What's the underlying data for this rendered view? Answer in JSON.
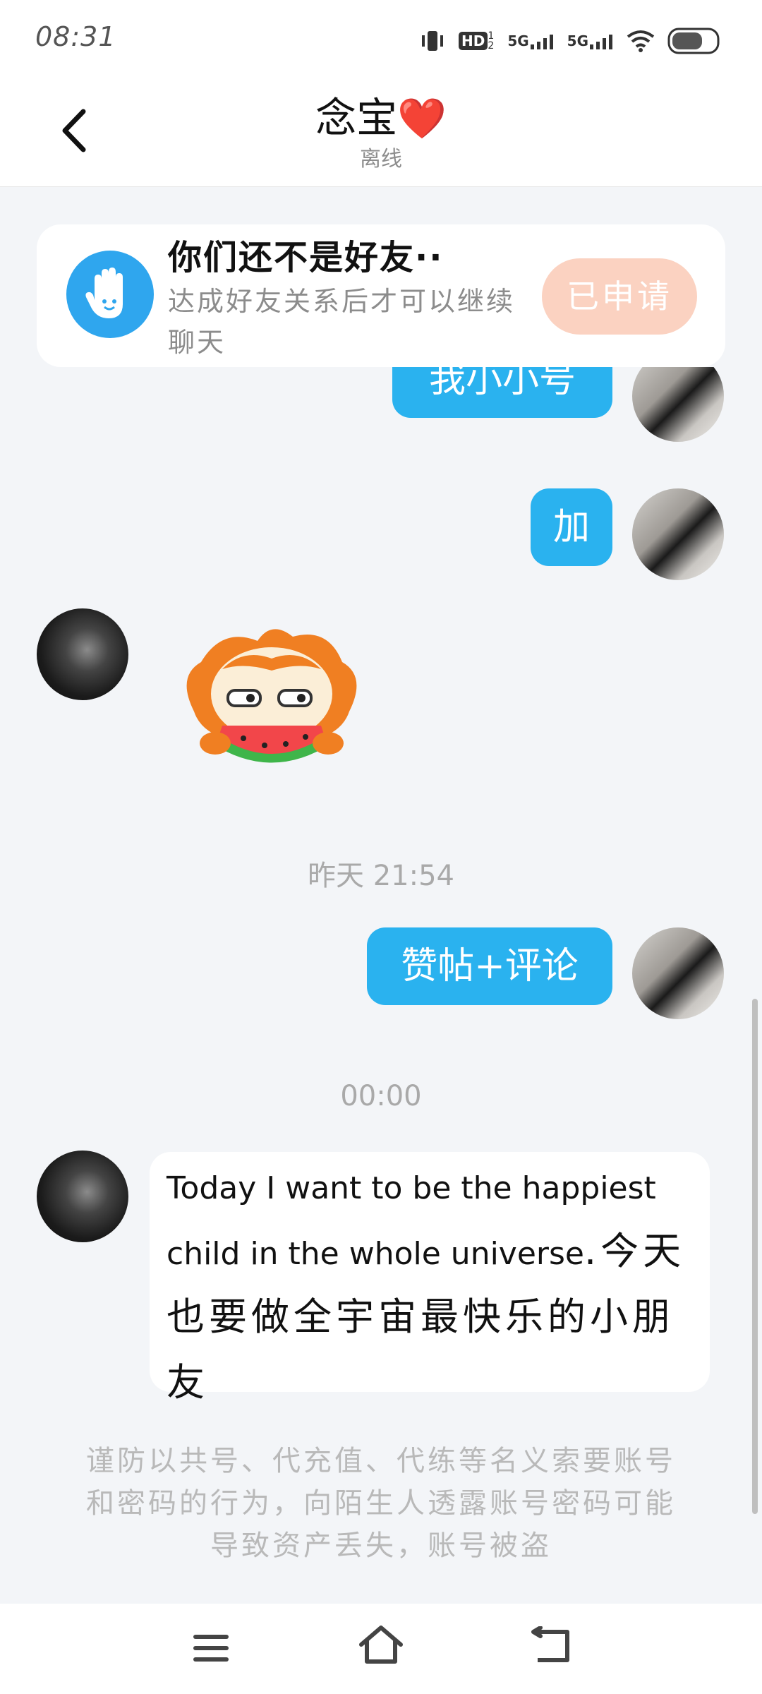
{
  "status_bar": {
    "time": "08:31",
    "hd_badge": "HD",
    "hd_sub": "1 2",
    "net1": "5G",
    "net2": "5G"
  },
  "header": {
    "title": "念宝",
    "title_emoji": "❤️",
    "status": "离线"
  },
  "friend_card": {
    "title": "你们还不是好友··",
    "description": "达成好友关系后才可以继续聊天",
    "button_label": "已申请"
  },
  "messages": [
    {
      "side": "me",
      "type": "text",
      "text": "我小小号"
    },
    {
      "side": "me",
      "type": "text",
      "text": "加"
    },
    {
      "side": "other",
      "type": "sticker",
      "icon": "watermelon-sticker"
    },
    {
      "side": "divider",
      "text": "昨天 21:54"
    },
    {
      "side": "me",
      "type": "text",
      "text": "赞帖+评论"
    },
    {
      "side": "divider",
      "text": "00:00"
    },
    {
      "side": "other",
      "type": "text",
      "text_en": "Today I want to be the happiest child in the whole universe",
      "text_cn": ".今天也要做全宇宙最快乐的小朋友"
    }
  ],
  "safety_notice": "谨防以共号、代充值、代练等名义索要账号和密码的行为，向陌生人透露账号密码可能导致资产丢失，账号被盗",
  "colors": {
    "bubble_me": "#2ab2ef",
    "applied_button": "#fbd2c1",
    "heart": "#e21f2a",
    "background": "#f3f5f8"
  },
  "nav": {
    "icons": [
      "menu-icon",
      "home-icon",
      "back-icon"
    ]
  }
}
